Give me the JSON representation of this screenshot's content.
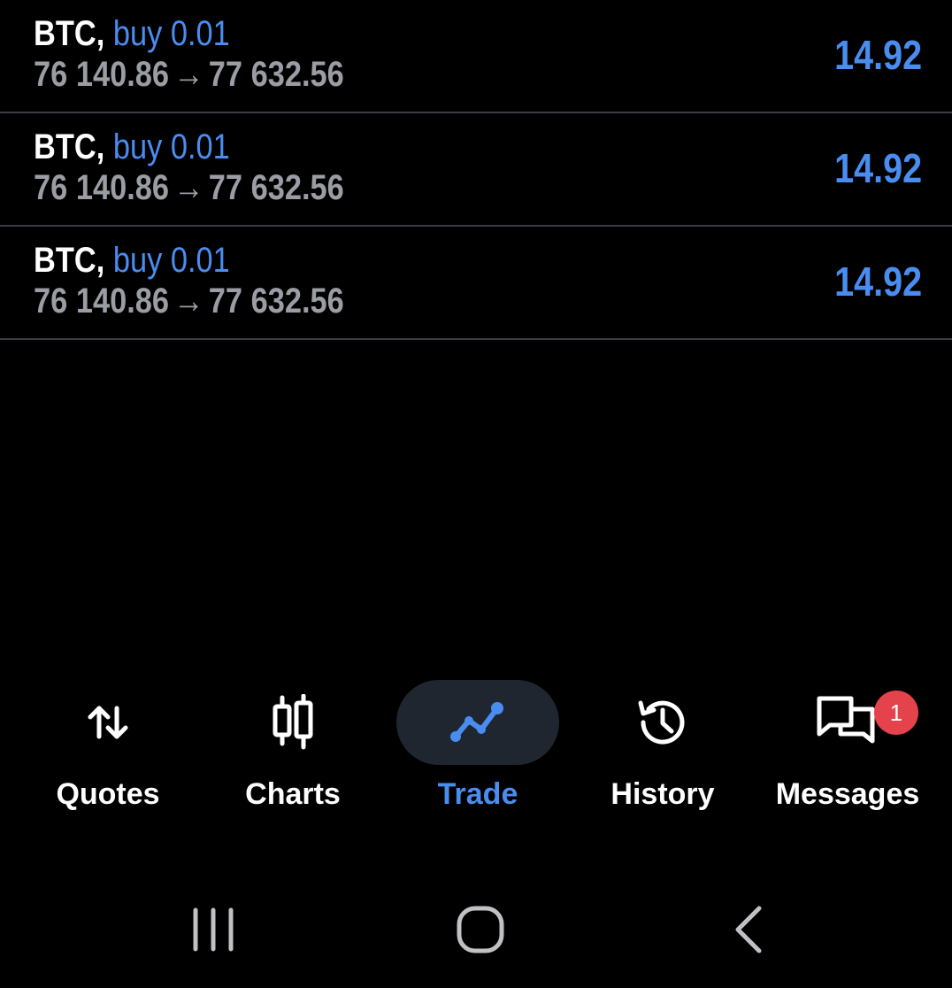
{
  "trades": [
    {
      "symbol": "BTC,",
      "side": "buy 0.01",
      "open_price": "76 140.86",
      "arrow": "→",
      "current_price": "77 632.56",
      "profit": "14.92"
    },
    {
      "symbol": "BTC,",
      "side": "buy 0.01",
      "open_price": "76 140.86",
      "arrow": "→",
      "current_price": "77 632.56",
      "profit": "14.92"
    },
    {
      "symbol": "BTC,",
      "side": "buy 0.01",
      "open_price": "76 140.86",
      "arrow": "→",
      "current_price": "77 632.56",
      "profit": "14.92"
    }
  ],
  "bottom_nav": {
    "active": "Trade",
    "items": [
      {
        "label": "Quotes",
        "icon": "up-down-arrows-icon"
      },
      {
        "label": "Charts",
        "icon": "candlestick-icon"
      },
      {
        "label": "Trade",
        "icon": "trend-line-icon"
      },
      {
        "label": "History",
        "icon": "history-clock-icon"
      },
      {
        "label": "Messages",
        "icon": "chat-bubbles-icon",
        "badge": "1"
      }
    ]
  },
  "system_nav": {
    "buttons": [
      "recent-apps-icon",
      "home-icon",
      "back-icon"
    ]
  },
  "colors": {
    "background": "#000000",
    "accent": "#4a8df0",
    "muted_text": "#9a9da3",
    "divider": "#3a3d42",
    "active_pill": "#1f2630",
    "badge": "#e5434b"
  }
}
